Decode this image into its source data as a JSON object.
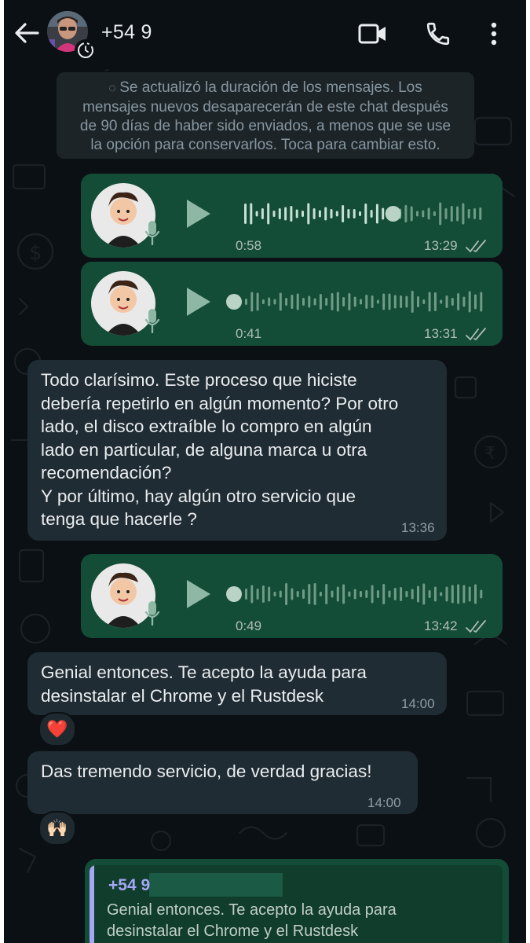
{
  "header": {
    "contact_name": "+54 9",
    "back_icon": "arrow-left-icon",
    "video_icon": "video-camera-icon",
    "call_icon": "phone-icon",
    "menu_icon": "more-vertical-icon"
  },
  "notice": {
    "lines": [
      "Se actualizó la duración de los mensajes. Los",
      "mensajes nuevos desaparecerán de este chat después",
      "de 90 días de haber sido enviados, a menos que se use",
      "la opción para conservarlos. Toca para cambiar esto."
    ]
  },
  "messages": [
    {
      "kind": "voice",
      "direction": "out",
      "duration": "0:58",
      "time": "13:29",
      "status": "read",
      "progress": 0.62
    },
    {
      "kind": "voice",
      "direction": "out",
      "duration": "0:41",
      "time": "13:31",
      "status": "read",
      "progress": 0.0
    },
    {
      "kind": "text",
      "direction": "in",
      "time": "13:36",
      "lines": [
        "Todo clarísimo. Este proceso que hiciste",
        "debería repetirlo en algún momento? Por otro",
        "lado, el disco extraíble lo compro en algún",
        "lado en particular, de alguna marca u otra",
        "recomendación?",
        "Y por último, hay algún otro servicio que",
        "tenga que hacerle ?"
      ]
    },
    {
      "kind": "voice",
      "direction": "out",
      "duration": "0:49",
      "time": "13:42",
      "status": "read",
      "progress": 0.0
    },
    {
      "kind": "text",
      "direction": "in",
      "time": "14:00",
      "lines": [
        "Genial entonces. Te acepto la ayuda para",
        "desinstalar el Chrome y el Rustdesk"
      ],
      "reaction": "❤️"
    },
    {
      "kind": "text",
      "direction": "in",
      "time": "14:00",
      "lines": [
        "Das tremendo servicio, de verdad gracias!"
      ],
      "reaction": "🙌🏻"
    }
  ],
  "reply": {
    "author": "+54 9",
    "lines": [
      "Genial entonces. Te acepto la ayuda para",
      "desinstalar el Chrome y el Rustdesk"
    ]
  },
  "colors": {
    "background": "#0b1014",
    "outgoing_bubble": "#144d37",
    "incoming_bubble": "#202c33",
    "quote_accent": "#a5a6f6"
  }
}
